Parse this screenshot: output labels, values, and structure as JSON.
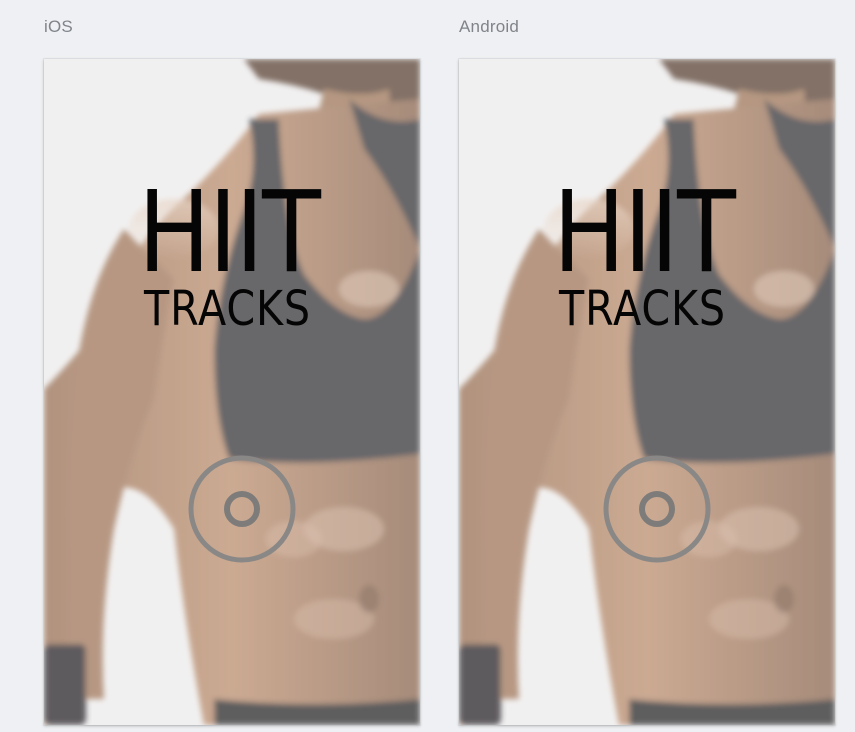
{
  "labels": {
    "ios": "iOS",
    "android": "Android"
  },
  "screens": [
    {
      "platform": "ios",
      "logo_line1": "HIIT",
      "logo_line2": "TRACKS"
    },
    {
      "platform": "android",
      "logo_line1": "HIIT",
      "logo_line2": "TRACKS"
    }
  ],
  "icons": {
    "start": "record-button-icon",
    "background": "athlete-photo"
  },
  "colors": {
    "background": "#eef0f3",
    "label": "#80848a",
    "logo": "#050505",
    "ring": "#8a8886"
  }
}
